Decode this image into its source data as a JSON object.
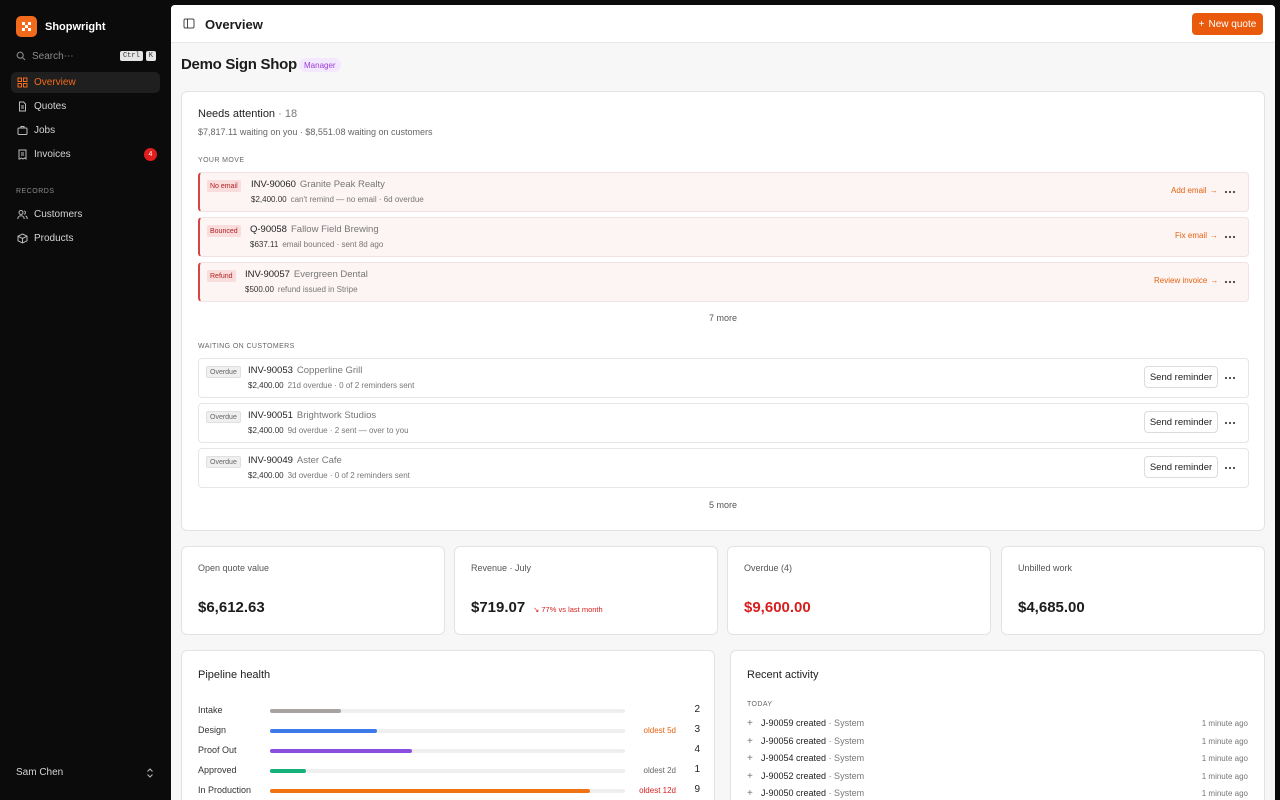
{
  "app": {
    "name": "Shopwright",
    "search_placeholder": "Search⋯",
    "search_keys": [
      "Ctrl",
      "K"
    ],
    "nav": [
      {
        "label": "Overview",
        "icon": "grid-icon",
        "active": true
      },
      {
        "label": "Quotes",
        "icon": "document-icon"
      },
      {
        "label": "Jobs",
        "icon": "briefcase-icon"
      },
      {
        "label": "Invoices",
        "icon": "receipt-icon",
        "badge": "4"
      }
    ],
    "records_label": "RECORDS",
    "records": [
      {
        "label": "Customers",
        "icon": "users-icon"
      },
      {
        "label": "Products",
        "icon": "box-icon"
      }
    ],
    "user": "Sam Chen"
  },
  "header": {
    "title": "Overview",
    "new_quote": "New quote"
  },
  "shop": {
    "name": "Demo Sign Shop",
    "role": "Manager"
  },
  "attention": {
    "title": "Needs attention",
    "count": "· 18",
    "summary": "$7,817.11 waiting on you · $8,551.08 waiting on customers",
    "your_move_label": "YOUR MOVE",
    "your_move": [
      {
        "tag": "No email",
        "id": "INV-90060",
        "customer": "Granite Peak Realty",
        "amount": "$2,400.00",
        "detail": "can't remind — no email · 6d overdue",
        "action": "Add email"
      },
      {
        "tag": "Bounced",
        "id": "Q-90058",
        "customer": "Fallow Field Brewing",
        "amount": "$637.11",
        "detail": "email bounced · sent 8d ago",
        "action": "Fix email"
      },
      {
        "tag": "Refund",
        "id": "INV-90057",
        "customer": "Evergreen Dental",
        "amount": "$500.00",
        "detail": "refund issued in Stripe",
        "action": "Review invoice"
      }
    ],
    "your_move_more": "7 more",
    "waiting_label": "WAITING ON CUSTOMERS",
    "waiting": [
      {
        "tag": "Overdue",
        "id": "INV-90053",
        "customer": "Copperline Grill",
        "amount": "$2,400.00",
        "detail": "21d overdue · 0 of 2 reminders sent",
        "action": "Send reminder"
      },
      {
        "tag": "Overdue",
        "id": "INV-90051",
        "customer": "Brightwork Studios",
        "amount": "$2,400.00",
        "detail": "9d overdue · 2 sent — over to you",
        "action": "Send reminder"
      },
      {
        "tag": "Overdue",
        "id": "INV-90049",
        "customer": "Aster Cafe",
        "amount": "$2,400.00",
        "detail": "3d overdue · 0 of 2 reminders sent",
        "action": "Send reminder"
      }
    ],
    "waiting_more": "5 more"
  },
  "stats": [
    {
      "label": "Open quote value",
      "value": "$6,612.63"
    },
    {
      "label": "Revenue · July",
      "value": "$719.07",
      "trend": "77% vs last month"
    },
    {
      "label": "Overdue (4)",
      "value": "$9,600.00",
      "color": "#d61f1f"
    },
    {
      "label": "Unbilled work",
      "value": "$4,685.00"
    }
  ],
  "pipeline": {
    "title": "Pipeline health",
    "stages": [
      {
        "label": "Intake",
        "count": "2",
        "fill": 0.2,
        "color": "#a8a3a0",
        "oldest": ""
      },
      {
        "label": "Design",
        "count": "3",
        "fill": 0.3,
        "color": "#3b7ae8",
        "oldest": "oldest 5d",
        "oldest_color": "#e3640f"
      },
      {
        "label": "Proof Out",
        "count": "4",
        "fill": 0.4,
        "color": "#8b4fe0",
        "oldest": ""
      },
      {
        "label": "Approved",
        "count": "1",
        "fill": 0.1,
        "color": "#16b07a",
        "oldest": "oldest 2d",
        "oldest_color": "#666666"
      },
      {
        "label": "In Production",
        "count": "9",
        "fill": 0.9,
        "color": "#f27314",
        "oldest": "oldest 12d",
        "oldest_color": "#d61f1f"
      }
    ]
  },
  "activity": {
    "title": "Recent activity",
    "group": "TODAY",
    "items": [
      {
        "text": "J-90059 created",
        "who": "· System",
        "time": "1 minute ago"
      },
      {
        "text": "J-90056 created",
        "who": "· System",
        "time": "1 minute ago"
      },
      {
        "text": "J-90054 created",
        "who": "· System",
        "time": "1 minute ago"
      },
      {
        "text": "J-90052 created",
        "who": "· System",
        "time": "1 minute ago"
      },
      {
        "text": "J-90050 created",
        "who": "· System",
        "time": "1 minute ago"
      }
    ]
  }
}
